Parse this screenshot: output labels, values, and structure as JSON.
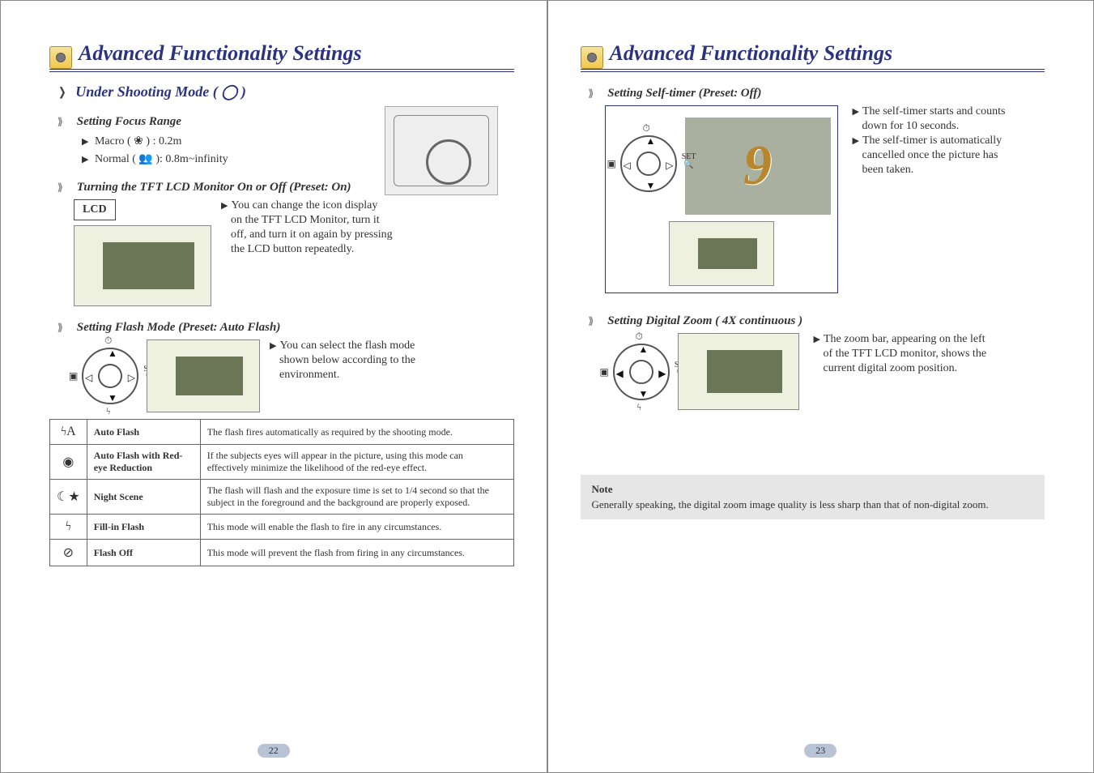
{
  "left": {
    "title": "Advanced Functionality Settings",
    "shooting_mode_head": "Under Shooting Mode (",
    "shooting_mode_tail": ")",
    "focus": {
      "head": "Setting Focus Range",
      "macro_label": "Macro (",
      "macro_val": ") : 0.2m",
      "normal_label": "Normal (",
      "normal_val": "): 0.8m~infinity"
    },
    "lcd": {
      "head": "Turning the TFT LCD Monitor On or Off  (Preset: On)",
      "lcd_label": "LCD",
      "p1": "You can change the icon display",
      "p2": "on the TFT LCD Monitor, turn it",
      "p3": "off, and turn it on again by pressing",
      "p4": "the LCD button repeatedly."
    },
    "flash": {
      "head": "Setting Flash Mode (Preset: Auto Flash)",
      "p1": "You can select  the flash mode",
      "p2": "shown below according to the",
      "p3": "environment."
    },
    "table": [
      {
        "icon": "ϟA",
        "name": "Auto Flash",
        "desc": "The flash fires automatically as required by the shooting mode."
      },
      {
        "icon": "◉",
        "name": "Auto Flash with Red-eye Reduction",
        "desc": "If the subjects eyes will appear  in the picture, using this mode can effectively minimize the likelihood of the red-eye effect."
      },
      {
        "icon": "☾★",
        "name": "Night Scene",
        "desc": "The flash will flash and the exposure time is set to 1/4 second so that the subject in the foreground and the background are properly exposed."
      },
      {
        "icon": "ϟ",
        "name": "Fill-in  Flash",
        "desc": "This mode will enable the flash to fire in any circumstances."
      },
      {
        "icon": "⊘",
        "name": "Flash Off",
        "desc": "This mode will prevent the flash from firing  in any circumstances."
      }
    ],
    "page_num": "22"
  },
  "right": {
    "title": "Advanced Functionality Settings",
    "timer": {
      "head": "Setting Self-timer (Preset: Off)",
      "big_digit": "9",
      "p1": "The self-timer starts and counts",
      "p2": "down for 10 seconds.",
      "p3": "The self-timer is automatically",
      "p4": "cancelled once the picture has",
      "p5": "been taken."
    },
    "zoom": {
      "head": "Setting Digital Zoom ( 4X continuous )",
      "p1": "The zoom bar, appearing on the left",
      "p2": "of the TFT LCD monitor, shows the",
      "p3": "current digital zoom position."
    },
    "note": {
      "title": "Note",
      "body": "Generally speaking, the digital zoom image quality is less sharp than that of non-digital zoom."
    },
    "page_num": "23"
  },
  "nav_labels": {
    "set": "SET",
    "timer_icon": "⏱",
    "flash_icon": "ϟ",
    "digi_icon": "▣"
  }
}
